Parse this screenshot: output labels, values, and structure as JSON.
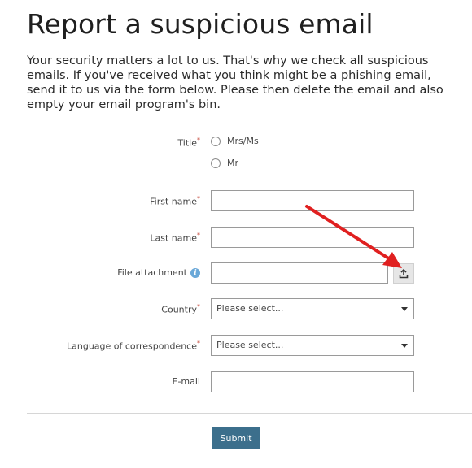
{
  "page": {
    "title": "Report a suspicious email",
    "intro": "Your security matters a lot to us. That's why we check all suspicious emails. If you've received what you think might be a phishing email, send it to us via the form below. Please then delete the email and also empty your email program's bin."
  },
  "form": {
    "title_label": "Title",
    "title_options": [
      "Mrs/Ms",
      "Mr"
    ],
    "first_name_label": "First name",
    "last_name_label": "Last name",
    "file_label": "File attachment",
    "info_glyph": "i",
    "country_label": "Country",
    "country_value": "Please select...",
    "language_label": "Language of correspondence",
    "language_value": "Please select...",
    "email_label": "E-mail",
    "required_mark": "*",
    "submit_label": "Submit"
  },
  "colors": {
    "submit_button": "#3c6f8c",
    "annotation_arrow": "#e02020",
    "info_icon": "#6aa8d8"
  },
  "icons": {
    "upload": "upload-icon",
    "info": "info-icon",
    "dropdown": "chevron-down-icon"
  }
}
